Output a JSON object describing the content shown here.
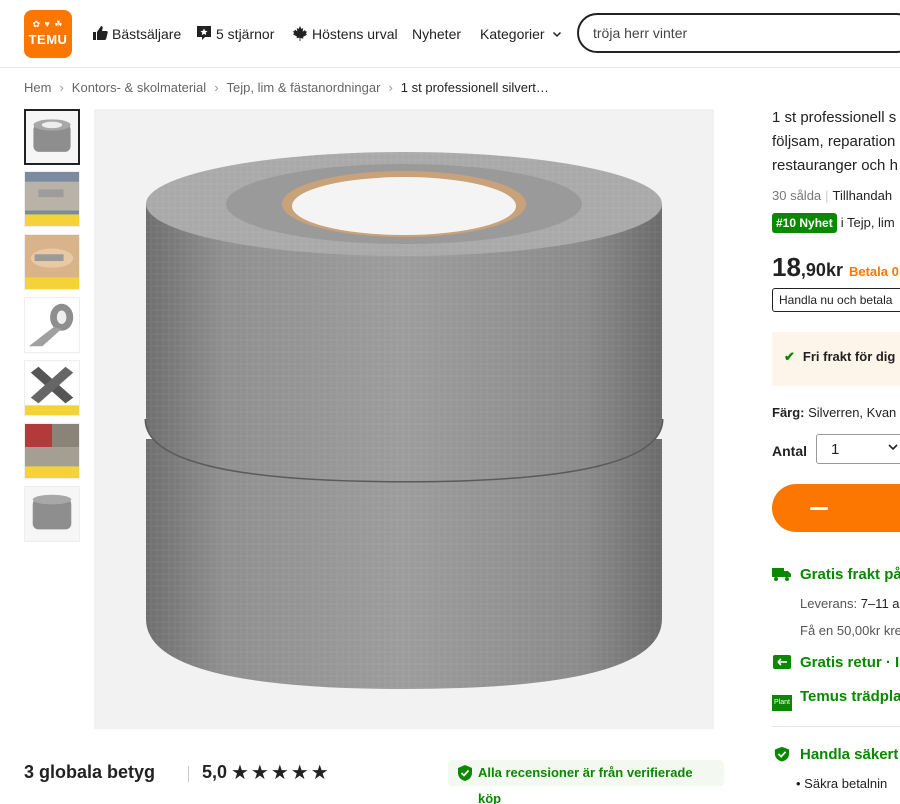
{
  "brand": {
    "logo_text": "TEMU",
    "logo_glyphs": "✿ ♥ ☘",
    "accent": "#fb7701",
    "green": "#0a8800"
  },
  "nav": {
    "items": [
      {
        "label": "Bästsäljare",
        "icon": "thumbs-up-icon"
      },
      {
        "label": "5 stjärnor",
        "icon": "star-badge-icon"
      },
      {
        "label": "Höstens urval",
        "icon": "maple-leaf-icon"
      },
      {
        "label": "Nyheter",
        "icon": ""
      },
      {
        "label": "Kategorier",
        "icon": "chevron-down-icon"
      }
    ]
  },
  "search": {
    "value": "tröja herr vinter"
  },
  "breadcrumb": {
    "items": [
      "Hem",
      "Kontors- & skolmaterial",
      "Tejp, lim & fästanordningar"
    ],
    "current": "1 st professionell silvert…",
    "separator": "›"
  },
  "gallery": {
    "thumbnails": [
      {
        "name": "tape-roll",
        "active": true
      },
      {
        "name": "repair-use"
      },
      {
        "name": "wrap-hand"
      },
      {
        "name": "tape-strip"
      },
      {
        "name": "cross-tape"
      },
      {
        "name": "applications"
      },
      {
        "name": "tape-roll-2"
      }
    ]
  },
  "reviews": {
    "count_label": "3 globala betyg",
    "score": "5,0",
    "stars": "★★★★★",
    "verified_label": "Alla recensioner är från verifierade köp"
  },
  "product": {
    "title_lines": [
      "1 st professionell s",
      "följsam, reparation",
      "restauranger och h"
    ],
    "sold": "30 sålda",
    "supplied": "Tillhandah",
    "rank_badge": "#10 Nyhet",
    "rank_in": "i Tejp, lim",
    "price_int": "18",
    "price_dec": ",90kr",
    "pay_label": "Betala 0",
    "installment": "Handla nu och betala",
    "free_shipping_banner": "Fri frakt för dig",
    "color_label": "Färg:",
    "color_value": "Silverren, Kvan",
    "qty_label": "Antal",
    "qty_value": "1"
  },
  "services": {
    "shipping_title": "Gratis frakt på",
    "delivery_label": "Leverans:",
    "delivery_value": "7–11 a",
    "credit_note": "Få en 50,00kr kre",
    "return_title": "Gratis retur · I",
    "tree_title": "Temus trädpla",
    "tree_badge": "Plant",
    "safe_title": "Handla säkert",
    "safe_bullet": "• Säkra betalnin"
  }
}
